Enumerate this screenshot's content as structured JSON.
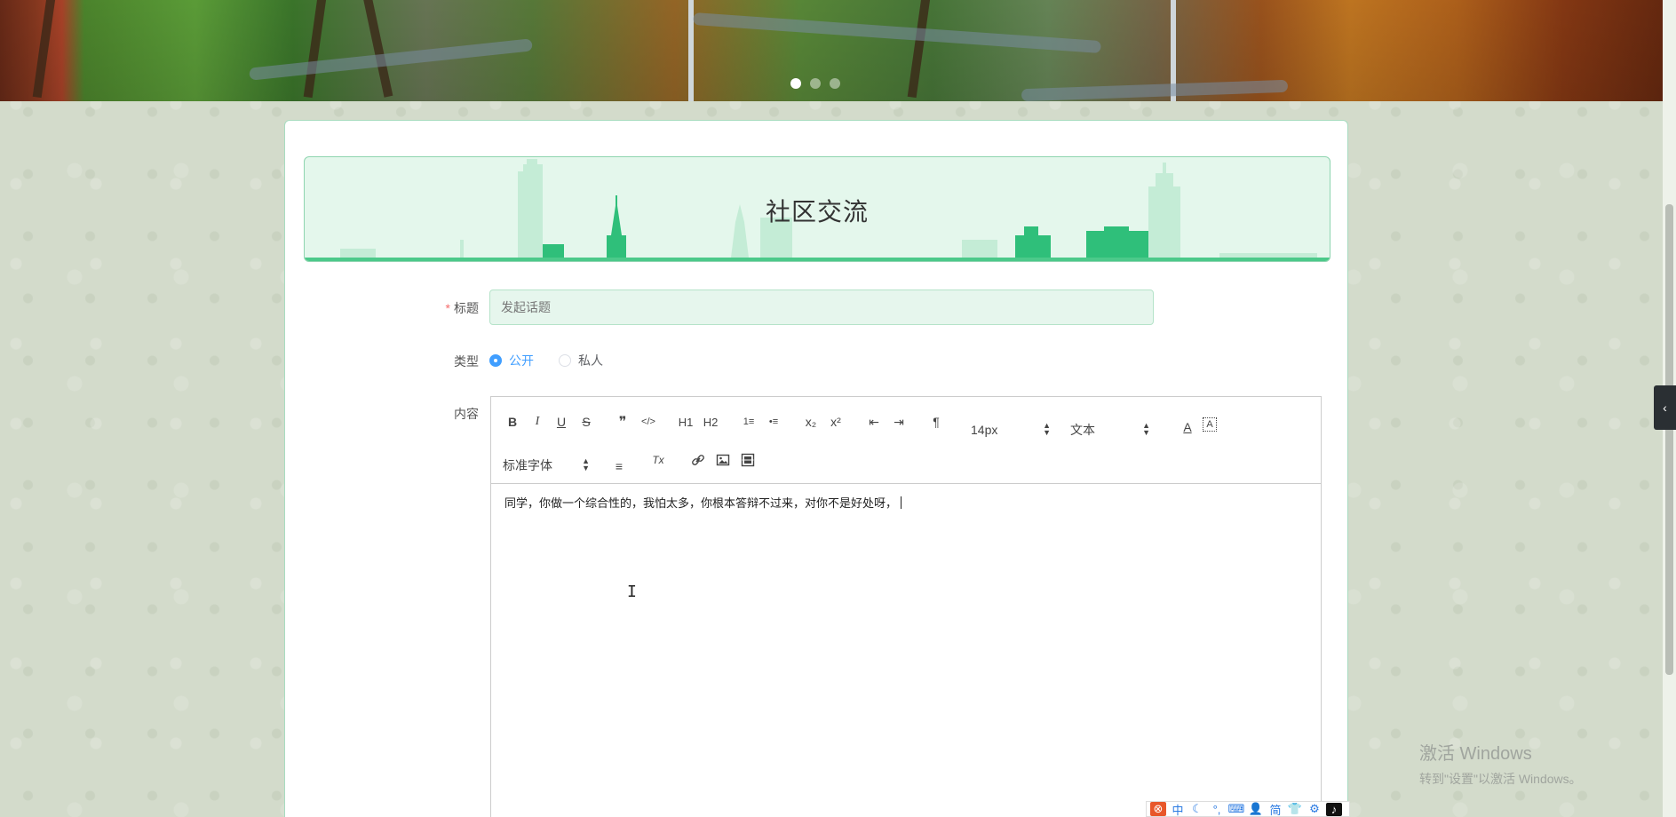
{
  "banner": {
    "slides": 3,
    "active_slide": 1
  },
  "page": {
    "header_title": "社区交流"
  },
  "form": {
    "title_label": "标题",
    "title_required_mark": "*",
    "title_placeholder": "发起话题",
    "title_value": "",
    "type_label": "类型",
    "type_options": [
      "公开",
      "私人"
    ],
    "type_selected": "公开",
    "content_label": "内容"
  },
  "editor": {
    "toolbar": {
      "bold": "B",
      "italic": "I",
      "underline": "U",
      "strike": "S",
      "blockquote": "❞",
      "code": "</>",
      "h1": "H1",
      "h2": "H2",
      "ordered_list": "1≡",
      "bullet_list": "•≡",
      "subscript": "x₂",
      "superscript": "x²",
      "outdent": "⇤",
      "indent": "⇥",
      "direction": "¶",
      "size_value": "14px",
      "header_value": "文本",
      "font_value": "标准字体",
      "color": "A",
      "background": "A",
      "align": "≡",
      "clean": "Tx",
      "link": "🔗",
      "image": "▣",
      "video": "▤"
    },
    "content": "同学，你做一个综合性的，我怕太多，你根本答辩不过来，对你不是好处呀，"
  },
  "watermark": {
    "line1": "激活 Windows",
    "line2": "转到\"设置\"以激活 Windows。"
  },
  "ime": {
    "items": [
      "中",
      "☾",
      "°,",
      "⌨",
      "👤",
      "简",
      "👕",
      "⚙"
    ]
  },
  "colors": {
    "accent_green": "#4cc98a",
    "header_bg": "#e4f7ec",
    "radio_blue": "#409eff",
    "required_red": "#f56c6c"
  }
}
